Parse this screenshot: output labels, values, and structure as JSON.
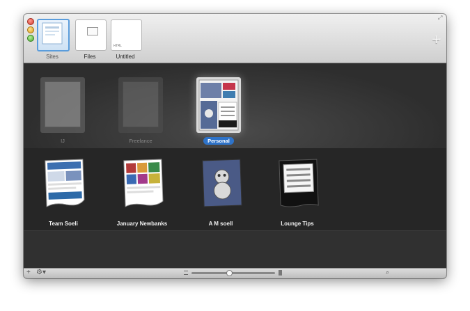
{
  "toolbar": {
    "tabs": [
      {
        "label": "Sites"
      },
      {
        "label": "Files"
      },
      {
        "label": "Untitled",
        "badge": "HTML"
      }
    ],
    "add_icon": "plus-icon",
    "add_chevron": "▾"
  },
  "groups": [
    {
      "label": "IJ"
    },
    {
      "label": "Freelance"
    },
    {
      "label": "Personal",
      "selected": true
    }
  ],
  "sites": [
    {
      "label": "Team Soeli"
    },
    {
      "label": "January Newbanks"
    },
    {
      "label": "A M soell"
    },
    {
      "label": "Lounge Tips"
    }
  ],
  "statusbar": {
    "add_glyph": "+",
    "gear_glyph": "⚙▾",
    "search_glyph": "⌕"
  }
}
